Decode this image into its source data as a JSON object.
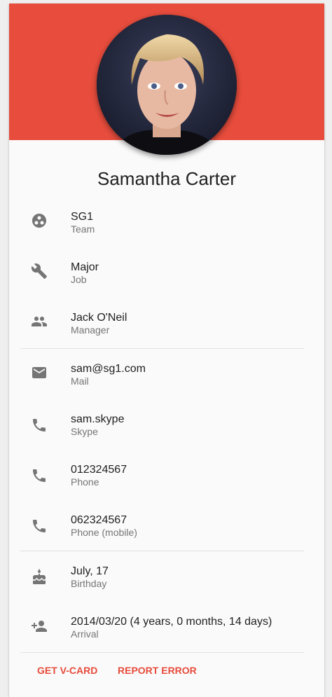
{
  "profile": {
    "name": "Samantha Carter",
    "accent_color": "#e74c3c",
    "avatar": "portrait-photo"
  },
  "details": [
    {
      "icon": "team-icon",
      "value": "SG1",
      "label": "Team"
    },
    {
      "icon": "wrench-icon",
      "value": "Major",
      "label": "Job"
    },
    {
      "icon": "people-icon",
      "value": "Jack O'Neil",
      "label": "Manager"
    },
    {
      "icon": "email-icon",
      "value": "sam@sg1.com",
      "label": "Mail"
    },
    {
      "icon": "phone-icon",
      "value": "sam.skype",
      "label": "Skype"
    },
    {
      "icon": "phone-icon",
      "value": "012324567",
      "label": "Phone"
    },
    {
      "icon": "phone-icon",
      "value": "062324567",
      "label": "Phone (mobile)"
    },
    {
      "icon": "cake-icon",
      "value": "July, 17",
      "label": "Birthday"
    },
    {
      "icon": "person-add-icon",
      "value": "2014/03/20 (4 years, 0 months, 14 days)",
      "label": "Arrival"
    }
  ],
  "actions": {
    "vcard": "GET V-CARD",
    "report": "REPORT ERROR"
  }
}
